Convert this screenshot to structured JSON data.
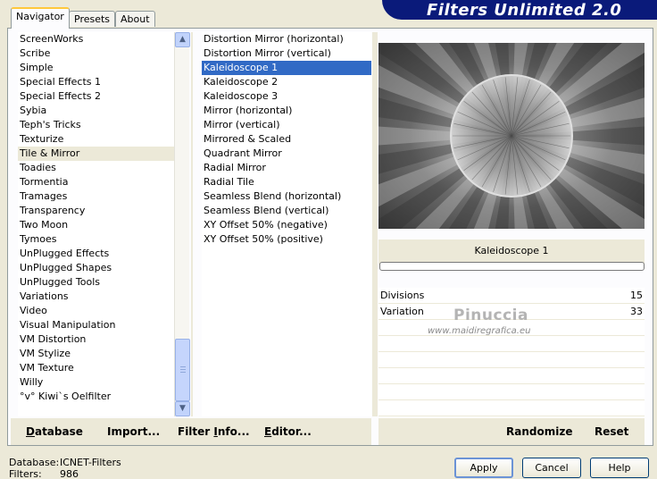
{
  "header": {
    "title": "Filters Unlimited 2.0"
  },
  "tabs": [
    {
      "label": "Navigator",
      "active": true
    },
    {
      "label": "Presets",
      "active": false
    },
    {
      "label": "About",
      "active": false
    }
  ],
  "categories": {
    "items": [
      "ScreenWorks",
      "Scribe",
      "Simple",
      "Special Effects 1",
      "Special Effects 2",
      "Sybia",
      "Teph's Tricks",
      "Texturize",
      "Tile & Mirror",
      "Toadies",
      "Tormentia",
      "Tramages",
      "Transparency",
      "Two Moon",
      "Tymoes",
      "UnPlugged Effects",
      "UnPlugged Shapes",
      "UnPlugged Tools",
      "Variations",
      "Video",
      "Visual Manipulation",
      "VM Distortion",
      "VM Stylize",
      "VM Texture",
      "Willy",
      "°v° Kiwi`s Oelfilter"
    ],
    "selected": "Tile & Mirror"
  },
  "filters": {
    "items": [
      "Distortion Mirror (horizontal)",
      "Distortion Mirror (vertical)",
      "Kaleidoscope 1",
      "Kaleidoscope 2",
      "Kaleidoscope 3",
      "Mirror (horizontal)",
      "Mirror (vertical)",
      "Mirrored & Scaled",
      "Quadrant Mirror",
      "Radial Mirror",
      "Radial Tile",
      "Seamless Blend (horizontal)",
      "Seamless Blend (vertical)",
      "XY Offset 50% (negative)",
      "XY Offset 50% (positive)"
    ],
    "selected": "Kaleidoscope 1"
  },
  "preview": {
    "filter_name": "Kaleidoscope 1",
    "progress": 0
  },
  "parameters": [
    {
      "label": "Divisions",
      "value": "15"
    },
    {
      "label": "Variation",
      "value": "33"
    }
  ],
  "watermark": {
    "name": "Pinuccia",
    "url": "www.maidiregrafica.eu"
  },
  "toolbar": {
    "database_label": {
      "u": "D",
      "rest": "atabase"
    },
    "import_label": {
      "pre": "Import",
      "u": "",
      "rest": "..."
    },
    "filter_info_label": {
      "pre": "Filter ",
      "u": "I",
      "rest": "nfo..."
    },
    "editor_label": {
      "pre": "",
      "u": "E",
      "rest": "ditor..."
    },
    "randomize_label": "Randomize",
    "reset_label": "Reset"
  },
  "status": {
    "database_label": "Database:",
    "database_value": "ICNET-Filters",
    "filters_label": "Filters:",
    "filters_value": "986"
  },
  "buttons": {
    "apply": "Apply",
    "cancel": "Cancel",
    "help": "Help"
  },
  "colors": {
    "banner": "#0a1a7a",
    "selection": "#316ac5",
    "face": "#ece9d8"
  }
}
